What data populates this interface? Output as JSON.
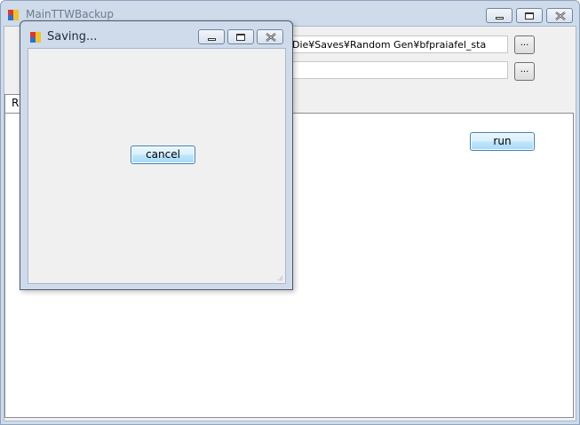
{
  "main_window": {
    "title": "MainTTWBackup",
    "path_value": "Die¥Saves¥Random Gen¥bfpraiafel_sta",
    "output_value": "",
    "browse_label_1": "...",
    "browse_label_2": "...",
    "tab_label": "R",
    "run_label": "run"
  },
  "dialog": {
    "title": "Saving...",
    "cancel_label": "cancel"
  },
  "icons": {
    "app": "app-icon",
    "minimize": "minimize-icon",
    "maximize": "maximize-icon",
    "close": "close-icon",
    "resize": "resize-grip-icon"
  },
  "colors": {
    "titlebar": "#cfdbea",
    "button_border_focus": "#3c7fb1",
    "icon_red": "#d83b2b",
    "icon_yellow": "#f2c12e",
    "icon_blue": "#2c6fd0"
  }
}
